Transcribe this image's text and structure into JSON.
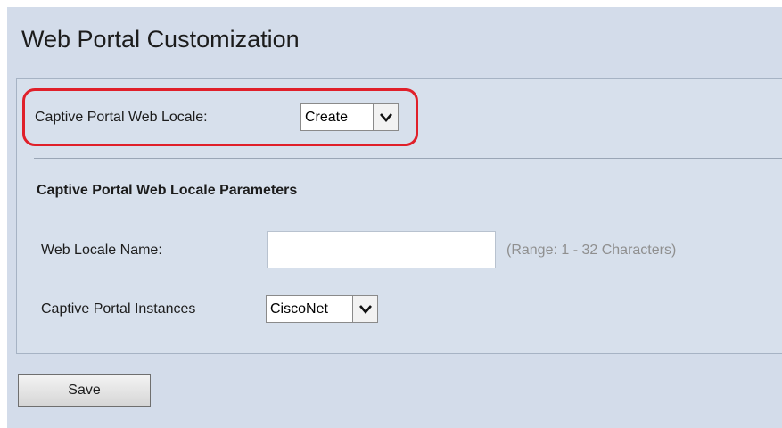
{
  "page": {
    "title": "Web Portal Customization"
  },
  "locale_row": {
    "label": "Captive Portal Web Locale:",
    "selected": "Create"
  },
  "parameters": {
    "heading": "Captive Portal Web Locale Parameters",
    "web_locale_name": {
      "label": "Web Locale Name:",
      "value": "",
      "hint": "(Range: 1 - 32 Characters)"
    },
    "instances": {
      "label": "Captive Portal Instances",
      "selected": "CiscoNet"
    }
  },
  "actions": {
    "save_label": "Save"
  },
  "colors": {
    "background": "#d3dcea",
    "panel": "#d7e0ec",
    "highlight": "#e0202a",
    "hint_text": "#8f8f8f"
  },
  "icons": {
    "dropdown": "chevron-down-icon"
  }
}
